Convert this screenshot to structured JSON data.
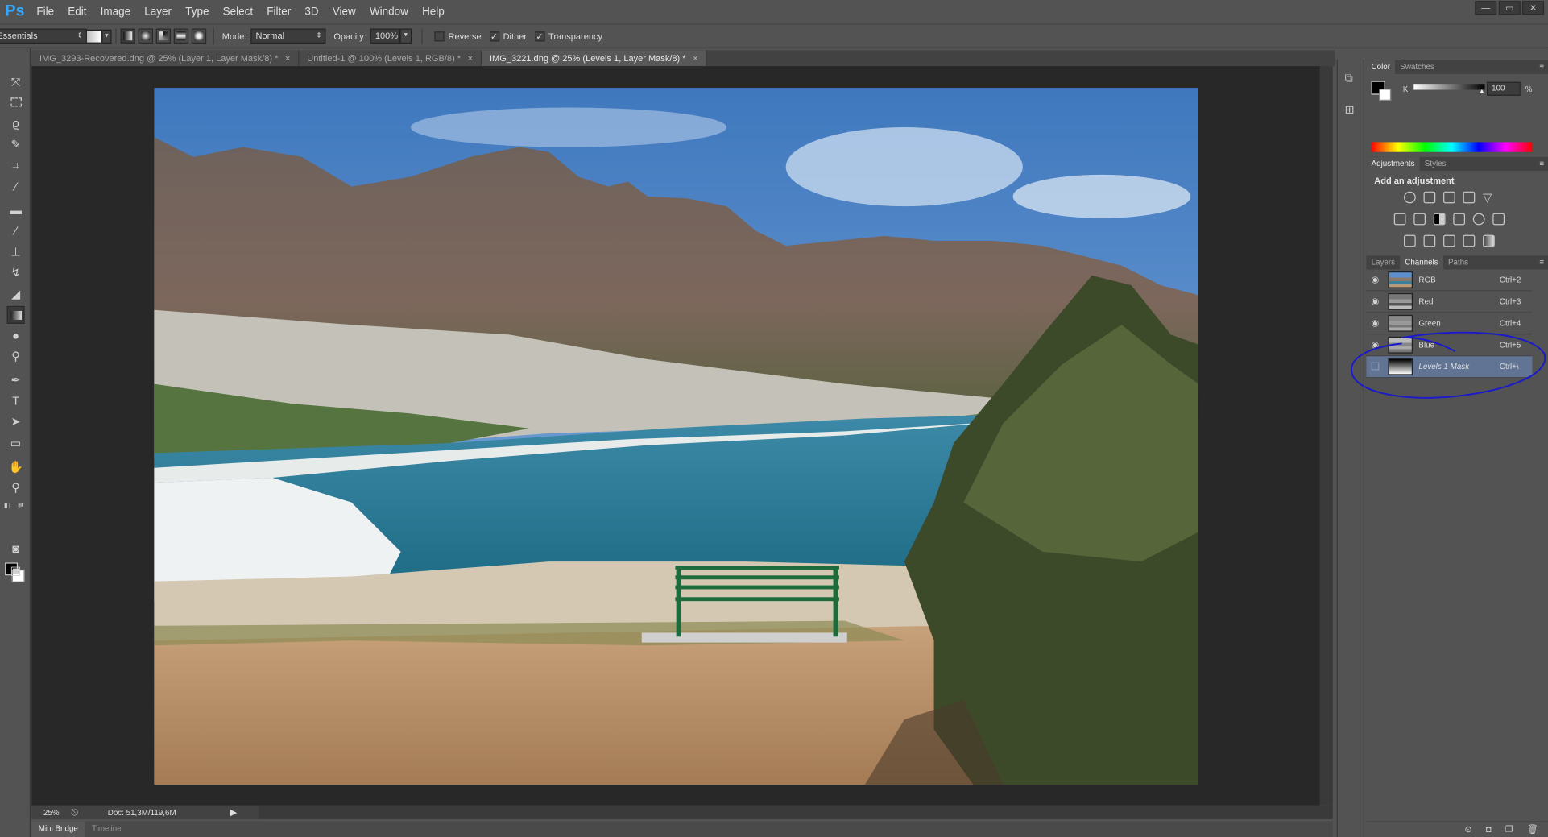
{
  "app": {
    "logo": "Ps"
  },
  "menu": [
    "File",
    "Edit",
    "Image",
    "Layer",
    "Type",
    "Select",
    "Filter",
    "3D",
    "View",
    "Window",
    "Help"
  ],
  "window_controls": {
    "minimize": "—",
    "restore": "▭",
    "close": "✕"
  },
  "options": {
    "mode_label": "Mode:",
    "mode_value": "Normal",
    "opacity_label": "Opacity:",
    "opacity_value": "100%",
    "reverse": "Reverse",
    "dither": "Dither",
    "transparency": "Transparency",
    "reverse_checked": false,
    "dither_checked": true,
    "transparency_checked": true,
    "workspace": "Essentials"
  },
  "tabs": [
    {
      "label": "IMG_3293-Recovered.dng @ 25% (Layer 1, Layer Mask/8) *",
      "active": false
    },
    {
      "label": "Untitled-1 @ 100% (Levels 1, RGB/8) *",
      "active": false
    },
    {
      "label": "IMG_3221.dng @ 25% (Levels 1, Layer Mask/8) *",
      "active": true
    }
  ],
  "status": {
    "zoom": "25%",
    "doc": "Doc: 51,3M/119,6M"
  },
  "bottom_tabs": [
    "Mini Bridge",
    "Timeline"
  ],
  "color_panel": {
    "tabs": [
      "Color",
      "Swatches"
    ],
    "channel": "K",
    "value": "100",
    "unit": "%"
  },
  "adjustments": {
    "tabs": [
      "Adjustments",
      "Styles"
    ],
    "heading": "Add an adjustment"
  },
  "layers_panel": {
    "tabs": [
      "Layers",
      "Channels",
      "Paths"
    ],
    "active_tab": "Channels",
    "channels": [
      {
        "name": "RGB",
        "shortcut": "Ctrl+2",
        "visible": true,
        "selected": false
      },
      {
        "name": "Red",
        "shortcut": "Ctrl+3",
        "visible": true,
        "selected": false
      },
      {
        "name": "Green",
        "shortcut": "Ctrl+4",
        "visible": true,
        "selected": false
      },
      {
        "name": "Blue",
        "shortcut": "Ctrl+5",
        "visible": true,
        "selected": false
      },
      {
        "name": "Levels 1 Mask",
        "shortcut": "Ctrl+\\",
        "visible": false,
        "selected": true
      }
    ]
  },
  "colors": {
    "ps_blue": "#31a8ff",
    "selection": "#617494",
    "annotation": "#1a1acc"
  }
}
